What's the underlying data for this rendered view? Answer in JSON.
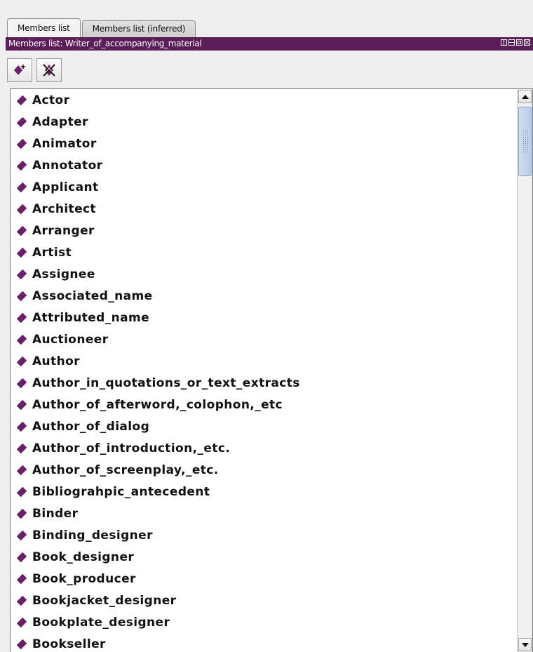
{
  "tabs": [
    {
      "label": "Members list",
      "active": true
    },
    {
      "label": "Members list (inferred)",
      "active": false
    }
  ],
  "panel": {
    "title": "Members list: Writer_of_accompanying_material",
    "title_color": "#5b1e5a"
  },
  "toolbar": {
    "buttons": [
      {
        "name": "add-member-button",
        "icon": "add-individual-icon"
      },
      {
        "name": "remove-member-button",
        "icon": "delete-individual-icon"
      }
    ]
  },
  "members": [
    "Actor",
    "Adapter",
    "Animator",
    "Annotator",
    "Applicant",
    "Architect",
    "Arranger",
    "Artist",
    "Assignee",
    "Associated_name",
    "Attributed_name",
    "Auctioneer",
    "Author",
    "Author_in_quotations_or_text_extracts",
    "Author_of_afterword,_colophon,_etc",
    "Author_of_dialog",
    "Author_of_introduction,_etc.",
    "Author_of_screenplay,_etc.",
    "Bibliograhpic_antecedent",
    "Binder",
    "Binding_designer",
    "Book_designer",
    "Book_producer",
    "Bookjacket_designer",
    "Bookplate_designer",
    "Bookseller"
  ],
  "colors": {
    "individual_diamond": "#6b1f6b",
    "background": "#eeeeee"
  }
}
